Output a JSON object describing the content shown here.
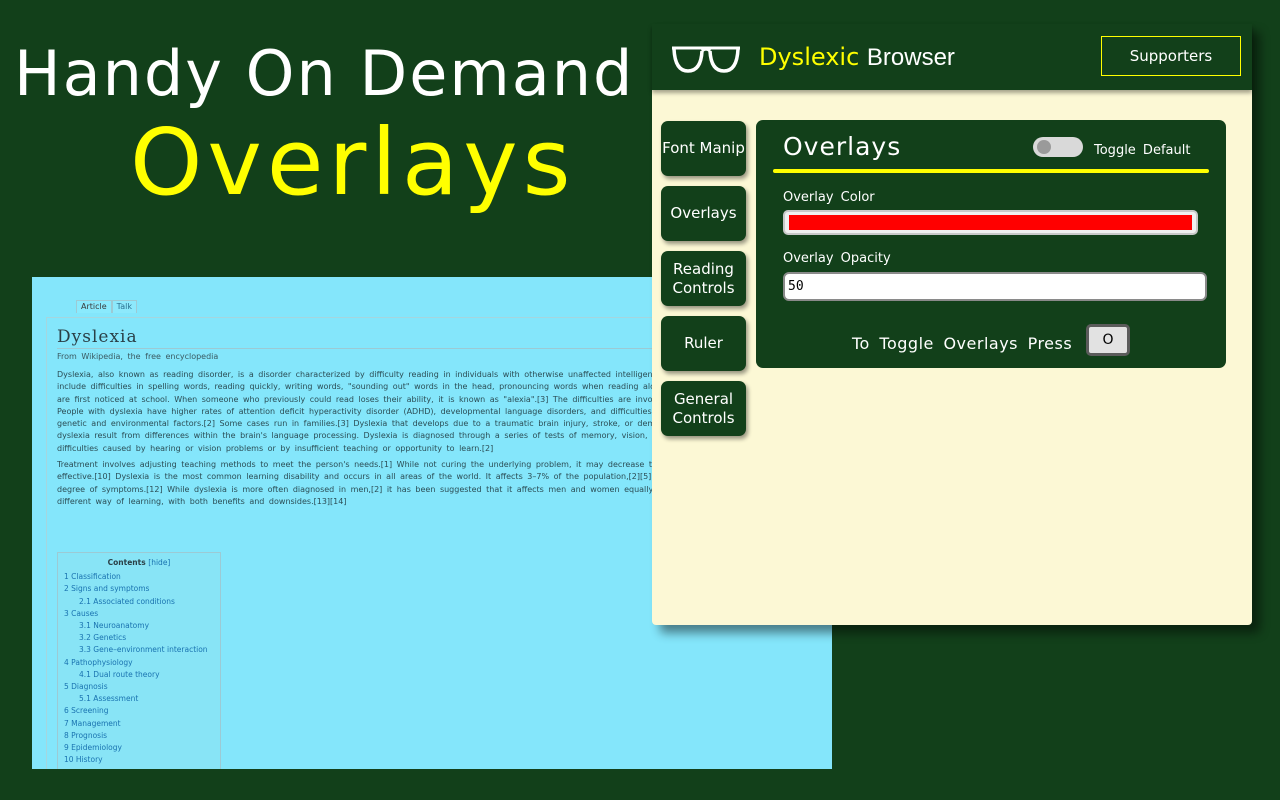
{
  "hero": {
    "line1": "Handy On Demand",
    "line2": "Overlays"
  },
  "wiki": {
    "tabs": [
      "Article",
      "Talk"
    ],
    "title": "Dyslexia",
    "subtitle": "From Wikipedia, the free encyclopedia",
    "p1": "Dyslexia, also known as reading disorder, is a disorder characterized by difficulty reading in individuals with otherwise unaffected intelligence. Different people are affected to different degrees.[2] Problems may include difficulties in spelling words, reading quickly, writing words, \"sounding out\" words in the head, pronouncing words when reading aloud and understanding what one reads.[3][7] Often these difficulties are first noticed at school. When someone who previously could read loses their ability, it is known as \"alexia\".[3] The difficulties are involuntary and people with this disorder have a normal desire to learn. People with dyslexia have higher rates of attention deficit hyperactivity disorder (ADHD), developmental language disorders, and difficulties with numbers. Dyslexia is believed to be caused by the interaction of genetic and environmental factors.[2] Some cases run in families.[3] Dyslexia that develops due to a traumatic brain injury, stroke, or dementia is called \"acquired dyslexia\".[1] The underlying mechanisms of dyslexia result from differences within the brain's language processing. Dyslexia is diagnosed through a series of tests of memory, vision, spelling, and reading skills.[4] Dyslexia is separate from reading difficulties caused by hearing or vision problems or by insufficient teaching or opportunity to learn.[2]",
    "p2": "Treatment involves adjusting teaching methods to meet the person's needs.[1] While not curing the underlying problem, it may decrease the degree of symptoms.[9] Treatments targeting vision are not effective.[10] Dyslexia is the most common learning disability and occurs in all areas of the world. It affects 3–7% of the population,[2][5] however, up to 20% of the general population may have some degree of symptoms.[12] While dyslexia is more often diagnosed in men,[2] it has been suggested that it affects men and women equally.[11] Some believe that dyslexia should be best considered as a different way of learning, with both benefits and downsides.[13][14]",
    "toc": {
      "title": "Contents",
      "hide": "[hide]",
      "items": [
        {
          "text": "1 Classification",
          "sub": false
        },
        {
          "text": "2 Signs and symptoms",
          "sub": false
        },
        {
          "text": "2.1 Associated conditions",
          "sub": true
        },
        {
          "text": "3 Causes",
          "sub": false
        },
        {
          "text": "3.1 Neuroanatomy",
          "sub": true
        },
        {
          "text": "3.2 Genetics",
          "sub": true
        },
        {
          "text": "3.3 Gene–environment interaction",
          "sub": true
        },
        {
          "text": "4 Pathophysiology",
          "sub": false
        },
        {
          "text": "4.1 Dual route theory",
          "sub": true
        },
        {
          "text": "5 Diagnosis",
          "sub": false
        },
        {
          "text": "5.1 Assessment",
          "sub": true
        },
        {
          "text": "6 Screening",
          "sub": false
        },
        {
          "text": "7 Management",
          "sub": false
        },
        {
          "text": "8 Prognosis",
          "sub": false
        },
        {
          "text": "9 Epidemiology",
          "sub": false
        },
        {
          "text": "10 History",
          "sub": false
        }
      ]
    }
  },
  "popup": {
    "brand_highlight": "Dyslexic",
    "brand_rest": "Browser",
    "supporters_label": "Supporters",
    "nav": [
      {
        "label": "Font Manip"
      },
      {
        "label": "Overlays"
      },
      {
        "label": "Reading Controls"
      },
      {
        "label": "Ruler"
      },
      {
        "label": "General Controls"
      }
    ],
    "panel": {
      "title": "Overlays",
      "toggle_label": "Toggle Default",
      "toggle_on": false,
      "color_label": "Overlay Color",
      "color_value": "#ff0000",
      "opacity_label": "Overlay Opacity",
      "opacity_value": "50",
      "press_label": "To Toggle Overlays Press",
      "key": "O"
    }
  },
  "colors": {
    "background": "#12401a",
    "accent": "#ffff00",
    "popup_bg": "#fcf8d5",
    "wiki_bg": "#84e6fb"
  }
}
